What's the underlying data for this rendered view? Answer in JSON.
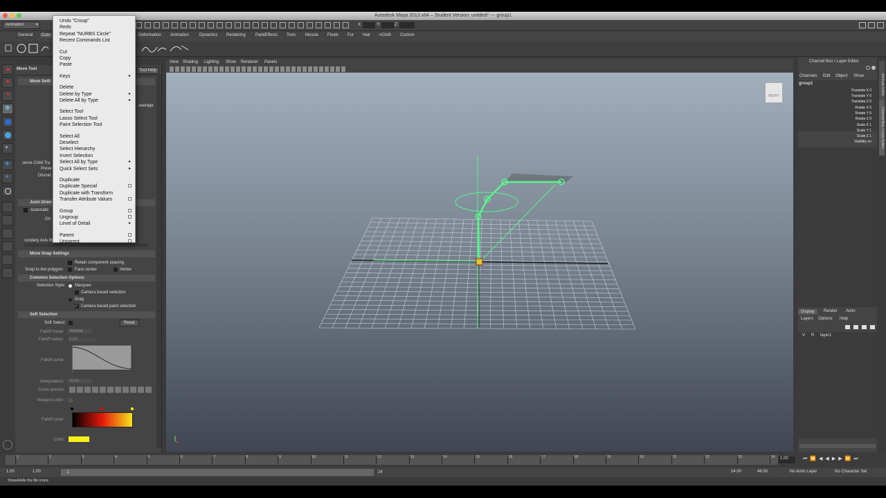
{
  "window": {
    "title": "Autodesk Maya 2013 x64 – Student Version: untitled*   ---   group1"
  },
  "statusline": {
    "mode": "Animation",
    "x_label": "X:",
    "y_label": "Y:",
    "z_label": "Z:"
  },
  "shelf_tabs": [
    "General",
    "Curv",
    "Deformation",
    "Animation",
    "Dynamics",
    "Rendering",
    "PaintEffects",
    "Toon",
    "Muscle",
    "Fluids",
    "Fur",
    "Hair",
    "nCloth",
    "Custom"
  ],
  "tool_settings": {
    "title": "Move Tool",
    "help": "Tool Help",
    "sections": {
      "move_settings": "Move Setti",
      "joint_orient": "Joint Orien",
      "move_snap": "Move Snap Settings",
      "common_selection": "Common Selection Options",
      "soft_selection": "Soft Selection"
    },
    "labels": {
      "average": "average",
      "preserve_child": "serve Child Tra",
      "prese": "Prese",
      "discrete": "Discret",
      "automatic": "Automatic",
      "orient": "Ori",
      "secondary_axis": "condary Axis W",
      "retain": "Retain component spacing",
      "snap_live": "Snap to live polygon:",
      "face_center": "Face center",
      "vertex": "Vertex",
      "selection_style": "Selection Style:",
      "marquee": "Marquee",
      "camera_based": "Camera based selection",
      "drag": "Drag",
      "camera_paint": "Camera based paint selection",
      "soft_select": "Soft Select:",
      "reset": "Reset",
      "falloff_mode": "Falloff mode:",
      "falloff_mode_value": "Volume",
      "falloff_radius": "Falloff radius:",
      "falloff_radius_value": "5.00",
      "falloff_curve": "Falloff curve:",
      "interpolation": "Interpolation:",
      "interpolation_value": "None",
      "curve_presets": "Curve presets:",
      "viewport_color": "Viewport color:",
      "falloff_color": "Falloff color:",
      "color": "Color:"
    },
    "colors": {
      "falloff_start": "#000000",
      "falloff_mid": "#e41a0b",
      "falloff_end": "#f6e21c",
      "color_swatch": "#f4f01a"
    }
  },
  "edit_menu": {
    "groups": [
      [
        {
          "label": "Undo \"Croup\""
        },
        {
          "label": "Redo"
        },
        {
          "label": "Repeat \"NURBS Circle\""
        },
        {
          "label": "Recent Commands List"
        }
      ],
      [
        {
          "label": "Cut"
        },
        {
          "label": "Copy"
        },
        {
          "label": "Paste"
        }
      ],
      [
        {
          "label": "Keys",
          "sub": true
        }
      ],
      [
        {
          "label": "Delete"
        },
        {
          "label": "Delete by Type",
          "sub": true
        },
        {
          "label": "Delete All by Type",
          "sub": true
        }
      ],
      [
        {
          "label": "Select Tool"
        },
        {
          "label": "Lasso Select Tool"
        },
        {
          "label": "Paint Selection Tool"
        }
      ],
      [
        {
          "label": "Select All"
        },
        {
          "label": "Deselect"
        },
        {
          "label": "Select Hierarchy"
        },
        {
          "label": "Invert Selection"
        },
        {
          "label": "Select All by Type",
          "sub": true
        },
        {
          "label": "Quick Select Sets",
          "sub": true
        }
      ],
      [
        {
          "label": "Duplicate"
        },
        {
          "label": "Duplicate Special",
          "opt": true
        },
        {
          "label": "Duplicate with Transform"
        },
        {
          "label": "Transfer Attribute Values",
          "opt": true
        }
      ],
      [
        {
          "label": "Group",
          "opt": true
        },
        {
          "label": "Ungroup",
          "opt": true
        },
        {
          "label": "Level of Detail",
          "sub": true
        }
      ],
      [
        {
          "label": "Parent",
          "opt": true
        },
        {
          "label": "Unparent",
          "opt": true
        }
      ]
    ]
  },
  "viewport": {
    "menus": [
      "View",
      "Shading",
      "Lighting",
      "Show",
      "Renderer",
      "Panels"
    ],
    "viewcube": "RIGHT",
    "accent": "#59f58a"
  },
  "channel_box": {
    "title": "Channel Box / Layer Editor",
    "menus": [
      "Channels",
      "Edit",
      "Object",
      "Show"
    ],
    "object": "group1",
    "channels": [
      "Translate X 0",
      "Translate Y 0",
      "Translate Z 0",
      "Rotate X 0",
      "Rotate Y 0",
      "Rotate Z 0",
      "Scale X 1",
      "Scale Y 1",
      "Scale Z 1",
      "Visibility on"
    ]
  },
  "layer_editor": {
    "tabs": [
      "Display",
      "Render",
      "Anim"
    ],
    "menus": [
      "Layers",
      "Options",
      "Help"
    ],
    "layer": {
      "v": "V",
      "r": "R",
      "name": "layer1"
    }
  },
  "right_tabs": [
    "Attribute Editor",
    "Channel Box / Layer Editor"
  ],
  "timeline": {
    "ticks": [
      "1",
      "2",
      "3",
      "4",
      "5",
      "6",
      "7",
      "8",
      "9",
      "10",
      "11",
      "12",
      "13",
      "14",
      "15",
      "16",
      "17",
      "18",
      "19",
      "20",
      "21",
      "22",
      "23",
      "24"
    ],
    "current_frame": "1.00"
  },
  "range": {
    "start": "1.00",
    "start2": "1.00",
    "range_start": "1",
    "range_end": "24",
    "end": "24.00",
    "end2": "48.00",
    "anim_layer": "No Anim Layer",
    "character": "No Character Set"
  },
  "help_line": "Show/Hide the file icons"
}
